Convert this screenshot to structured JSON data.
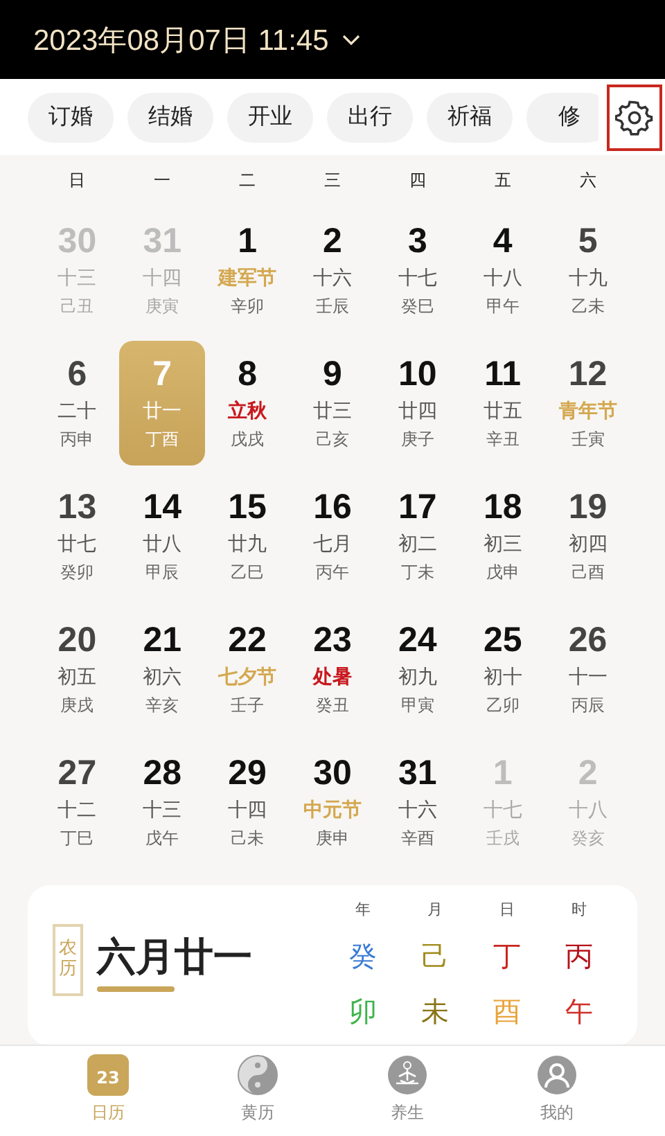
{
  "header": {
    "datetime": "2023年08月07日 11:45"
  },
  "chips": [
    {
      "label": "订婚"
    },
    {
      "label": "结婚"
    },
    {
      "label": "开业"
    },
    {
      "label": "出行"
    },
    {
      "label": "祈福"
    },
    {
      "label": "修"
    }
  ],
  "weekdays": [
    "日",
    "一",
    "二",
    "三",
    "四",
    "五",
    "六"
  ],
  "days": [
    {
      "date": "30",
      "lunar": "十三",
      "ganzhi": "己丑",
      "kind": "plain",
      "in_month": false,
      "selected": false
    },
    {
      "date": "31",
      "lunar": "十四",
      "ganzhi": "庚寅",
      "kind": "plain",
      "in_month": false,
      "selected": false
    },
    {
      "date": "1",
      "lunar": "建军节",
      "ganzhi": "辛卯",
      "kind": "festival",
      "in_month": true,
      "selected": false
    },
    {
      "date": "2",
      "lunar": "十六",
      "ganzhi": "壬辰",
      "kind": "plain",
      "in_month": true,
      "selected": false
    },
    {
      "date": "3",
      "lunar": "十七",
      "ganzhi": "癸巳",
      "kind": "plain",
      "in_month": true,
      "selected": false
    },
    {
      "date": "4",
      "lunar": "十八",
      "ganzhi": "甲午",
      "kind": "plain",
      "in_month": true,
      "selected": false
    },
    {
      "date": "5",
      "lunar": "十九",
      "ganzhi": "乙未",
      "kind": "plain",
      "in_month": true,
      "selected": false
    },
    {
      "date": "6",
      "lunar": "二十",
      "ganzhi": "丙申",
      "kind": "plain",
      "in_month": true,
      "selected": false
    },
    {
      "date": "7",
      "lunar": "廿一",
      "ganzhi": "丁酉",
      "kind": "plain",
      "in_month": true,
      "selected": true
    },
    {
      "date": "8",
      "lunar": "立秋",
      "ganzhi": "戊戌",
      "kind": "term",
      "in_month": true,
      "selected": false
    },
    {
      "date": "9",
      "lunar": "廿三",
      "ganzhi": "己亥",
      "kind": "plain",
      "in_month": true,
      "selected": false
    },
    {
      "date": "10",
      "lunar": "廿四",
      "ganzhi": "庚子",
      "kind": "plain",
      "in_month": true,
      "selected": false
    },
    {
      "date": "11",
      "lunar": "廿五",
      "ganzhi": "辛丑",
      "kind": "plain",
      "in_month": true,
      "selected": false
    },
    {
      "date": "12",
      "lunar": "青年节",
      "ganzhi": "壬寅",
      "kind": "festival",
      "in_month": true,
      "selected": false
    },
    {
      "date": "13",
      "lunar": "廿七",
      "ganzhi": "癸卯",
      "kind": "plain",
      "in_month": true,
      "selected": false
    },
    {
      "date": "14",
      "lunar": "廿八",
      "ganzhi": "甲辰",
      "kind": "plain",
      "in_month": true,
      "selected": false
    },
    {
      "date": "15",
      "lunar": "廿九",
      "ganzhi": "乙巳",
      "kind": "plain",
      "in_month": true,
      "selected": false
    },
    {
      "date": "16",
      "lunar": "七月",
      "ganzhi": "丙午",
      "kind": "plain",
      "in_month": true,
      "selected": false
    },
    {
      "date": "17",
      "lunar": "初二",
      "ganzhi": "丁未",
      "kind": "plain",
      "in_month": true,
      "selected": false
    },
    {
      "date": "18",
      "lunar": "初三",
      "ganzhi": "戊申",
      "kind": "plain",
      "in_month": true,
      "selected": false
    },
    {
      "date": "19",
      "lunar": "初四",
      "ganzhi": "己酉",
      "kind": "plain",
      "in_month": true,
      "selected": false
    },
    {
      "date": "20",
      "lunar": "初五",
      "ganzhi": "庚戌",
      "kind": "plain",
      "in_month": true,
      "selected": false
    },
    {
      "date": "21",
      "lunar": "初六",
      "ganzhi": "辛亥",
      "kind": "plain",
      "in_month": true,
      "selected": false
    },
    {
      "date": "22",
      "lunar": "七夕节",
      "ganzhi": "壬子",
      "kind": "festival",
      "in_month": true,
      "selected": false
    },
    {
      "date": "23",
      "lunar": "处暑",
      "ganzhi": "癸丑",
      "kind": "term",
      "in_month": true,
      "selected": false
    },
    {
      "date": "24",
      "lunar": "初九",
      "ganzhi": "甲寅",
      "kind": "plain",
      "in_month": true,
      "selected": false
    },
    {
      "date": "25",
      "lunar": "初十",
      "ganzhi": "乙卯",
      "kind": "plain",
      "in_month": true,
      "selected": false
    },
    {
      "date": "26",
      "lunar": "十一",
      "ganzhi": "丙辰",
      "kind": "plain",
      "in_month": true,
      "selected": false
    },
    {
      "date": "27",
      "lunar": "十二",
      "ganzhi": "丁巳",
      "kind": "plain",
      "in_month": true,
      "selected": false
    },
    {
      "date": "28",
      "lunar": "十三",
      "ganzhi": "戊午",
      "kind": "plain",
      "in_month": true,
      "selected": false
    },
    {
      "date": "29",
      "lunar": "十四",
      "ganzhi": "己未",
      "kind": "plain",
      "in_month": true,
      "selected": false
    },
    {
      "date": "30",
      "lunar": "中元节",
      "ganzhi": "庚申",
      "kind": "festival",
      "in_month": true,
      "selected": false
    },
    {
      "date": "31",
      "lunar": "十六",
      "ganzhi": "辛酉",
      "kind": "plain",
      "in_month": true,
      "selected": false
    },
    {
      "date": "1",
      "lunar": "十七",
      "ganzhi": "壬戌",
      "kind": "plain",
      "in_month": false,
      "selected": false
    },
    {
      "date": "2",
      "lunar": "十八",
      "ganzhi": "癸亥",
      "kind": "plain",
      "in_month": false,
      "selected": false
    }
  ],
  "lunar_card": {
    "badge": "农历",
    "date": "六月廿一",
    "pillars": [
      {
        "label": "年",
        "stem": {
          "char": "癸",
          "color": "#3a7bd5"
        },
        "branch": {
          "char": "卯",
          "color": "#3bb54a"
        }
      },
      {
        "label": "月",
        "stem": {
          "char": "己",
          "color": "#a08a1a"
        },
        "branch": {
          "char": "未",
          "color": "#8a7416"
        }
      },
      {
        "label": "日",
        "stem": {
          "char": "丁",
          "color": "#c8281e"
        },
        "branch": {
          "char": "酉",
          "color": "#e8a33a"
        }
      },
      {
        "label": "时",
        "stem": {
          "char": "丙",
          "color": "#b5121b"
        },
        "branch": {
          "char": "午",
          "color": "#d0302a"
        }
      }
    ]
  },
  "tab_bar": [
    {
      "label": "日历",
      "icon_text": "23",
      "selected": true
    },
    {
      "label": "黄历",
      "selected": false
    },
    {
      "label": "养生",
      "selected": false
    },
    {
      "label": "我的",
      "selected": false
    }
  ]
}
